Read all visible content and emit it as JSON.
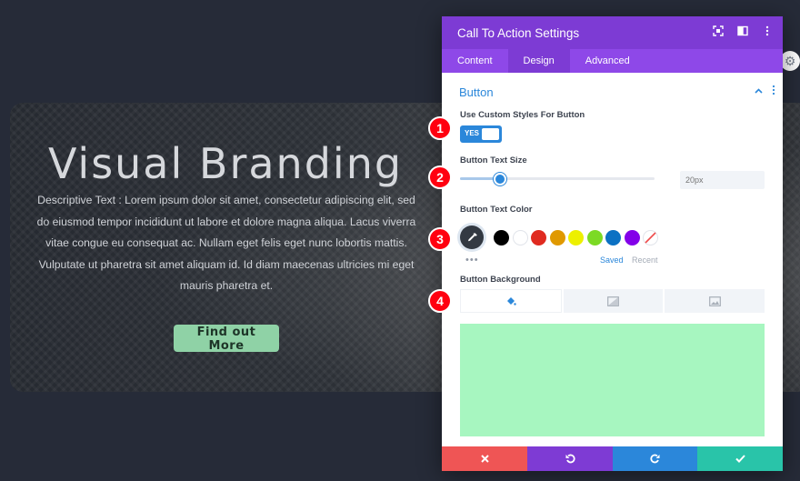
{
  "hero": {
    "title": "Visual Branding",
    "description": "Descriptive Text : Lorem ipsum dolor sit amet, consectetur adipiscing elit, sed do eiusmod tempor incididunt ut labore et dolore magna aliqua. Lacus viverra vitae congue eu consequat ac. Nullam eget felis eget nunc lobortis mattis. Vulputate ut pharetra sit amet aliquam id. Id diam maecenas ultricies mi eget mauris pharetra et.",
    "button_label": "Find out More"
  },
  "panel": {
    "title": "Call To Action Settings",
    "header_icons": [
      "expand-icon",
      "columns-icon",
      "more-vertical-icon"
    ],
    "tabs": [
      {
        "label": "Content"
      },
      {
        "label": "Design"
      },
      {
        "label": "Advanced"
      }
    ],
    "active_tab": "Design",
    "section_title": "Button"
  },
  "fields": {
    "custom_styles_label": "Use Custom Styles For Button",
    "toggle_value": "YES",
    "text_size_label": "Button Text Size",
    "text_size_placeholder": "20px",
    "text_size_slider_fraction": 0.2,
    "text_color_label": "Button Text Color",
    "background_label": "Button Background",
    "saved_label": "Saved",
    "recent_label": "Recent",
    "more_dots": "•••"
  },
  "swatches": [
    {
      "name": "black",
      "color": "#000000"
    },
    {
      "name": "white",
      "color": "#ffffff"
    },
    {
      "name": "red",
      "color": "#e02b20"
    },
    {
      "name": "orange",
      "color": "#e09900"
    },
    {
      "name": "yellow",
      "color": "#edf000"
    },
    {
      "name": "green",
      "color": "#7cda24"
    },
    {
      "name": "blue",
      "color": "#0c71c3"
    },
    {
      "name": "purple",
      "color": "#8300e9"
    },
    {
      "name": "none",
      "color": "transparent"
    }
  ],
  "background_tabs": [
    "paint-bucket-icon",
    "gradient-icon",
    "image-icon"
  ],
  "background_color": "#a7f6c0",
  "footer": [
    {
      "name": "cancel",
      "icon": "close-icon",
      "color": "#ef5555"
    },
    {
      "name": "undo",
      "icon": "undo-icon",
      "color": "#7e3bd4"
    },
    {
      "name": "redo",
      "icon": "redo-icon",
      "color": "#2b87da"
    },
    {
      "name": "save",
      "icon": "check-icon",
      "color": "#29c4a9"
    }
  ],
  "markers": [
    "1",
    "2",
    "3",
    "4"
  ],
  "colors": {
    "panel_header": "#7d3bd4",
    "tabs_bar": "#8e48e8",
    "accent_blue": "#2b87da",
    "cta_button": "#8fd2a6"
  }
}
